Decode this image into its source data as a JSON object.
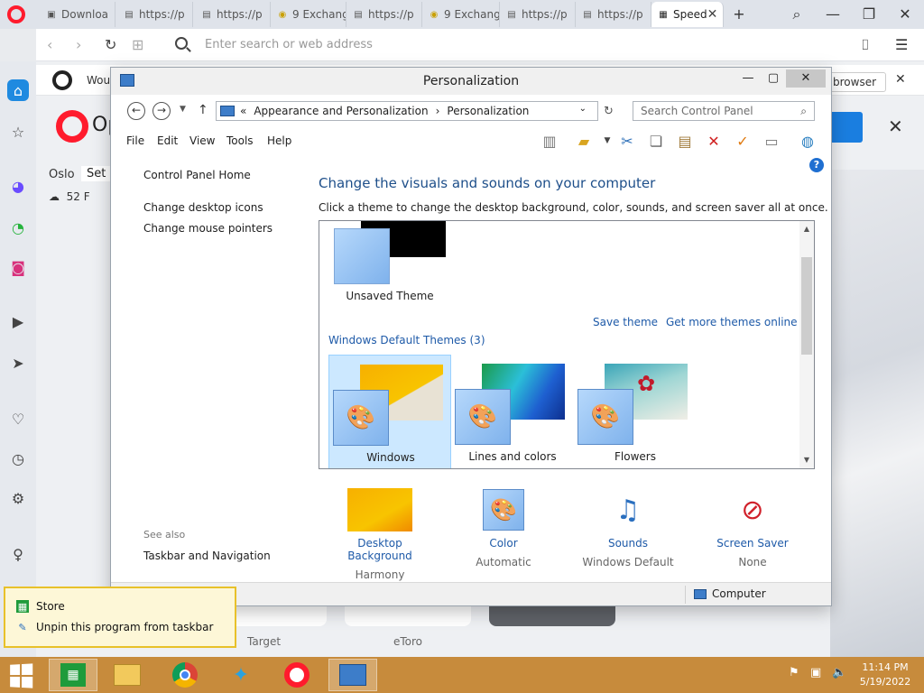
{
  "browser": {
    "tabs": [
      {
        "label": "Downloa",
        "icon": "page-icon"
      },
      {
        "label": "https://p",
        "icon": "page-icon"
      },
      {
        "label": "https://p",
        "icon": "page-icon"
      },
      {
        "label": "9 Exchang",
        "icon": "exchange-icon"
      },
      {
        "label": "https://p",
        "icon": "page-icon"
      },
      {
        "label": "9 Exchang",
        "icon": "exchange-icon"
      },
      {
        "label": "https://p",
        "icon": "page-icon"
      },
      {
        "label": "https://p",
        "icon": "page-icon"
      },
      {
        "label": "Speed",
        "icon": "speed-dial-icon",
        "active": true
      }
    ],
    "address_placeholder": "Enter search or web address",
    "notice_text": "Wou",
    "notice_button": "browser",
    "opera_word": "Op",
    "weather": {
      "city": "Oslo",
      "set_label": "Set",
      "temp": "52 F"
    },
    "tiles": [
      {
        "label": "Target"
      },
      {
        "label": "eToro"
      }
    ]
  },
  "window": {
    "title": "Personalization",
    "breadcrumb": [
      "Appearance and Personalization",
      "Personalization"
    ],
    "search_placeholder": "Search Control Panel",
    "menu": [
      "File",
      "Edit",
      "View",
      "Tools",
      "Help"
    ],
    "left_pane": {
      "home": "Control Panel Home",
      "links": [
        "Change desktop icons",
        "Change mouse pointers"
      ],
      "see_also_title": "See also",
      "see_also_links": [
        "Taskbar and Navigation"
      ]
    },
    "heading": "Change the visuals and sounds on your computer",
    "subheading": "Click a theme to change the desktop background, color, sounds, and screen saver all at once.",
    "unsaved_theme": "Unsaved Theme",
    "theme_links": [
      "Save theme",
      "Get more themes online"
    ],
    "group_title": "Windows Default Themes (3)",
    "themes": [
      {
        "label": "Windows",
        "selected": true
      },
      {
        "label": "Lines and colors",
        "selected": false
      },
      {
        "label": "Flowers",
        "selected": false
      }
    ],
    "bottom_items": [
      {
        "link": "Desktop Background",
        "sub": "Harmony"
      },
      {
        "link": "Color",
        "sub": "Automatic"
      },
      {
        "link": "Sounds",
        "sub": "Windows Default"
      },
      {
        "link": "Screen Saver",
        "sub": "None"
      }
    ],
    "status": "Computer"
  },
  "jump_list": {
    "items": [
      "Store",
      "Unpin this program from taskbar"
    ]
  },
  "taskbar": {
    "time": "11:14 PM",
    "date": "5/19/2022",
    "colors": {
      "taskbar": "#c78b3c",
      "accent": "#1f6fd1",
      "selection": "#cce8ff"
    }
  }
}
